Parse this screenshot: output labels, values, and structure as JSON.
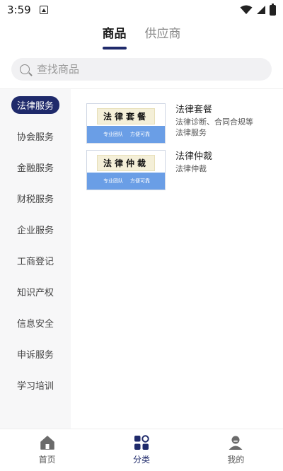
{
  "status_bar": {
    "time": "3:59",
    "icons": [
      "app-notification-icon",
      "wifi-icon",
      "signal-icon",
      "battery-icon"
    ]
  },
  "tabs": [
    {
      "label": "商品",
      "active": true
    },
    {
      "label": "供应商",
      "active": false
    }
  ],
  "search": {
    "placeholder": "查找商品"
  },
  "sidebar": {
    "items": [
      {
        "label": "法律服务",
        "active": true
      },
      {
        "label": "协会服务"
      },
      {
        "label": "金融服务"
      },
      {
        "label": "财税服务"
      },
      {
        "label": "企业服务"
      },
      {
        "label": "工商登记"
      },
      {
        "label": "知识产权"
      },
      {
        "label": "信息安全"
      },
      {
        "label": "申诉服务"
      },
      {
        "label": "学习培训"
      }
    ]
  },
  "products": [
    {
      "name": "法律套餐",
      "description_lines": [
        "法律诊断、合同合规等",
        "法律服务"
      ],
      "thumb": {
        "title": "法律套餐",
        "band_left": "专业团队",
        "band_right": "方便可靠"
      }
    },
    {
      "name": "法律仲裁",
      "description_lines": [
        "法律仲裁"
      ],
      "thumb": {
        "title": "法律仲裁",
        "band_left": "专业团队",
        "band_right": "方便可靠"
      }
    }
  ],
  "bottom_nav": [
    {
      "label": "首页",
      "icon": "home-icon",
      "active": false
    },
    {
      "label": "分类",
      "icon": "category-icon",
      "active": true
    },
    {
      "label": "我的",
      "icon": "profile-icon",
      "active": false
    }
  ],
  "colors": {
    "accent": "#1f2a6b",
    "thumb_band": "#6a9ee6",
    "sidebar_bg": "#f7f7f8"
  }
}
